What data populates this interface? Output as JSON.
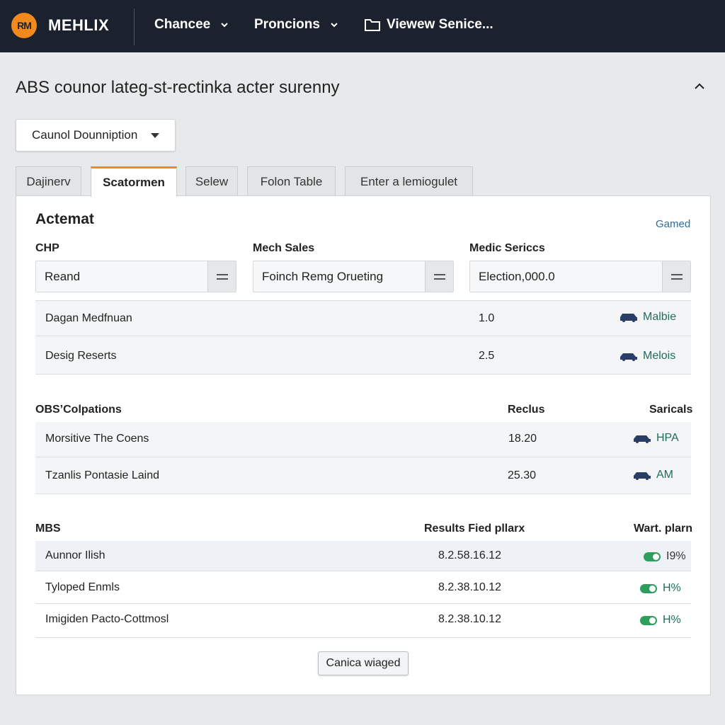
{
  "nav": {
    "logo_mark": "RM",
    "brand": "MEHLIX",
    "items": [
      {
        "label": "Chancee"
      },
      {
        "label": "Proncions"
      },
      {
        "label": "Viewew Senice..."
      }
    ]
  },
  "page": {
    "title": "ABS counor lateg-st-rectinka acter surenny",
    "dropdown_value": "Caunol Dounniption"
  },
  "tabs": [
    {
      "label": "Dajinerv"
    },
    {
      "label": "Scatormen"
    },
    {
      "label": "Selew"
    },
    {
      "label": "Folon Table"
    },
    {
      "label": "Enter a lemiogulet"
    }
  ],
  "section1": {
    "title": "Actemat",
    "link": "Gamed",
    "fields": [
      {
        "label": "CHP",
        "value": "Reand"
      },
      {
        "label": "Mech Sales",
        "value": "Foinch Remg Orueting"
      },
      {
        "label": "Medic Sericcs",
        "value": "Election,000.0"
      }
    ],
    "rows": [
      {
        "name": "Dagan Medfnuan",
        "value": "1.0",
        "status": "Malbie"
      },
      {
        "name": "Desig Reserts",
        "value": "2.5",
        "status": "Melois"
      }
    ]
  },
  "section2": {
    "headers": [
      "OBS’Colpations",
      "Reclus",
      "Saricals"
    ],
    "rows": [
      {
        "name": "Morsitive The Coens",
        "value": "18.20",
        "status": "HPA"
      },
      {
        "name": "Tzanlis Pontasie Laind",
        "value": "25.30",
        "status": "AM"
      }
    ]
  },
  "section3": {
    "headers": [
      "MBS",
      "Results Fied pllarx",
      "Wart. plarn"
    ],
    "rows": [
      {
        "name": "Aunnor Ilish",
        "value": "8.2.58.16.12",
        "status": "I9%"
      },
      {
        "name": "Tyloped Enmls",
        "value": "8.2.38.10.12",
        "status": "H%"
      },
      {
        "name": "Imigiden Pacto-Cottmosl",
        "value": "8.2.38.10.12",
        "status": "H%"
      }
    ]
  },
  "action_button": "Canica wiaged",
  "colors": {
    "topbar": "#1c222d",
    "accent": "#f08a1c",
    "link": "#2b6f9e",
    "status_green": "#2e9e5f",
    "car_icon": "#2a3d66"
  },
  "icons": [
    "logo-mark",
    "chevron-down-icon",
    "folder-icon",
    "chevron-up-icon",
    "menu-icon",
    "car-icon",
    "toggle-icon"
  ]
}
